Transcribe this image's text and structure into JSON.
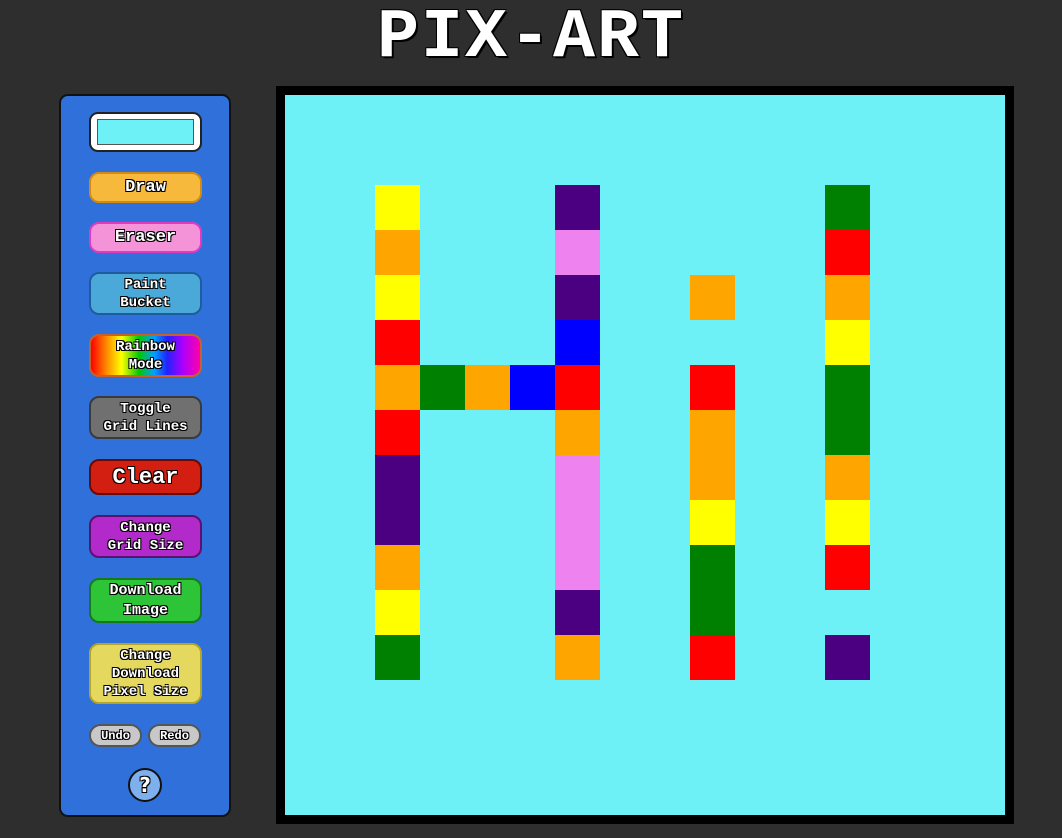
{
  "app": {
    "title": "PIX-ART"
  },
  "toolbar": {
    "current_color": "#6df0f6",
    "draw_label": "Draw",
    "eraser_label": "Eraser",
    "paint_bucket_label": "Paint\nBucket",
    "rainbow_label": "Rainbow\nMode",
    "grid_lines_label": "Toggle\nGrid Lines",
    "clear_label": "Clear",
    "grid_size_label": "Change\nGrid Size",
    "download_label": "Download\nImage",
    "pixel_size_label": "Change\nDownload\nPixel Size",
    "undo_label": "Undo",
    "redo_label": "Redo",
    "help_label": "?"
  },
  "canvas": {
    "background": "#6df0f6",
    "grid_columns": 16,
    "grid_rows": 16,
    "pixels": [
      {
        "col": 2,
        "row": 2,
        "color": "#ffff00"
      },
      {
        "col": 2,
        "row": 3,
        "color": "#ffa500"
      },
      {
        "col": 2,
        "row": 4,
        "color": "#ffff00"
      },
      {
        "col": 2,
        "row": 5,
        "color": "#ff0000"
      },
      {
        "col": 2,
        "row": 6,
        "color": "#ffa500"
      },
      {
        "col": 2,
        "row": 7,
        "color": "#ff0000"
      },
      {
        "col": 2,
        "row": 8,
        "color": "#4b0082"
      },
      {
        "col": 2,
        "row": 9,
        "color": "#4b0082"
      },
      {
        "col": 2,
        "row": 10,
        "color": "#ffa500"
      },
      {
        "col": 2,
        "row": 11,
        "color": "#ffff00"
      },
      {
        "col": 2,
        "row": 12,
        "color": "#008000"
      },
      {
        "col": 3,
        "row": 6,
        "color": "#008000"
      },
      {
        "col": 4,
        "row": 6,
        "color": "#ffa500"
      },
      {
        "col": 5,
        "row": 6,
        "color": "#0000ff"
      },
      {
        "col": 6,
        "row": 2,
        "color": "#4b0082"
      },
      {
        "col": 6,
        "row": 3,
        "color": "#ee82ee"
      },
      {
        "col": 6,
        "row": 4,
        "color": "#4b0082"
      },
      {
        "col": 6,
        "row": 5,
        "color": "#0000ff"
      },
      {
        "col": 6,
        "row": 6,
        "color": "#ff0000"
      },
      {
        "col": 6,
        "row": 7,
        "color": "#ffa500"
      },
      {
        "col": 6,
        "row": 8,
        "color": "#ee82ee"
      },
      {
        "col": 6,
        "row": 9,
        "color": "#ee82ee"
      },
      {
        "col": 6,
        "row": 10,
        "color": "#ee82ee"
      },
      {
        "col": 6,
        "row": 11,
        "color": "#4b0082"
      },
      {
        "col": 6,
        "row": 12,
        "color": "#ffa500"
      },
      {
        "col": 9,
        "row": 4,
        "color": "#ffa500"
      },
      {
        "col": 9,
        "row": 6,
        "color": "#ff0000"
      },
      {
        "col": 9,
        "row": 7,
        "color": "#ffa500"
      },
      {
        "col": 9,
        "row": 8,
        "color": "#ffa500"
      },
      {
        "col": 9,
        "row": 9,
        "color": "#ffff00"
      },
      {
        "col": 9,
        "row": 10,
        "color": "#008000"
      },
      {
        "col": 9,
        "row": 11,
        "color": "#008000"
      },
      {
        "col": 9,
        "row": 12,
        "color": "#ff0000"
      },
      {
        "col": 12,
        "row": 2,
        "color": "#008000"
      },
      {
        "col": 12,
        "row": 3,
        "color": "#ff0000"
      },
      {
        "col": 12,
        "row": 4,
        "color": "#ffa500"
      },
      {
        "col": 12,
        "row": 5,
        "color": "#ffff00"
      },
      {
        "col": 12,
        "row": 6,
        "color": "#008000"
      },
      {
        "col": 12,
        "row": 7,
        "color": "#008000"
      },
      {
        "col": 12,
        "row": 8,
        "color": "#ffa500"
      },
      {
        "col": 12,
        "row": 9,
        "color": "#ffff00"
      },
      {
        "col": 12,
        "row": 10,
        "color": "#ff0000"
      },
      {
        "col": 12,
        "row": 12,
        "color": "#4b0082"
      }
    ]
  }
}
